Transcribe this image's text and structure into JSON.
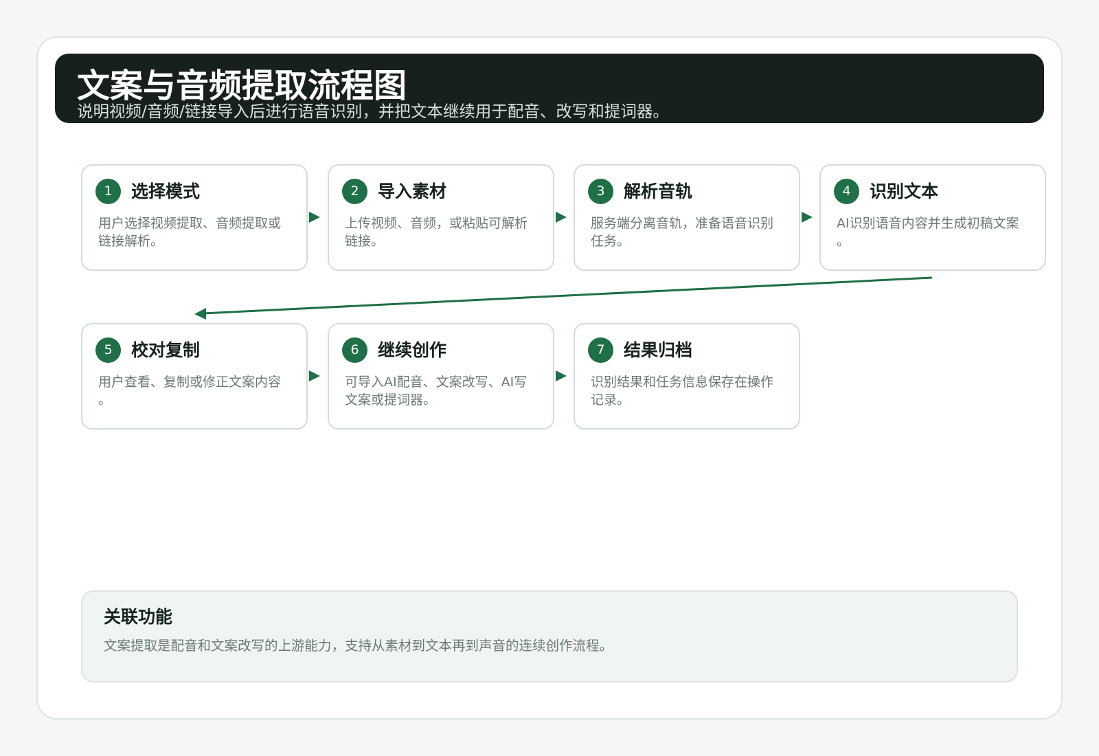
{
  "header": {
    "title": "文案与音频提取流程图",
    "subtitle": "说明视频/音频/链接导入后进行语音识别，并把文本继续用于配音、改写和提词器。"
  },
  "steps": [
    {
      "number": "1",
      "title": "选择模式",
      "description": "用户选择视频提取、音频提取或链接解析。"
    },
    {
      "number": "2",
      "title": "导入素材",
      "description": "上传视频、音频，或粘贴可解析链接。"
    },
    {
      "number": "3",
      "title": "解析音轨",
      "description": "服务端分离音轨，准备语音识别任务。"
    },
    {
      "number": "4",
      "title": "识别文本",
      "description": "AI识别语音内容并生成初稿文案。"
    },
    {
      "number": "5",
      "title": "校对复制",
      "description": "用户查看、复制或修正文案内容。"
    },
    {
      "number": "6",
      "title": "继续创作",
      "description": "可导入AI配音、文案改写、AI写文案或提词器。"
    },
    {
      "number": "7",
      "title": "结果归档",
      "description": "识别结果和任务信息保存在操作记录。"
    }
  ],
  "related": {
    "title": "关联功能",
    "description": "文案提取是配音和文案改写的上游能力，支持从素材到文本再到声音的连续创作流程。"
  },
  "colors": {
    "accent": "#1f6f47",
    "header_bg": "#18201c",
    "page_bg": "#f5f7f6",
    "card_border": "#d3ddd8",
    "text_main": "#17231d",
    "text_muted": "#6b7a72"
  }
}
